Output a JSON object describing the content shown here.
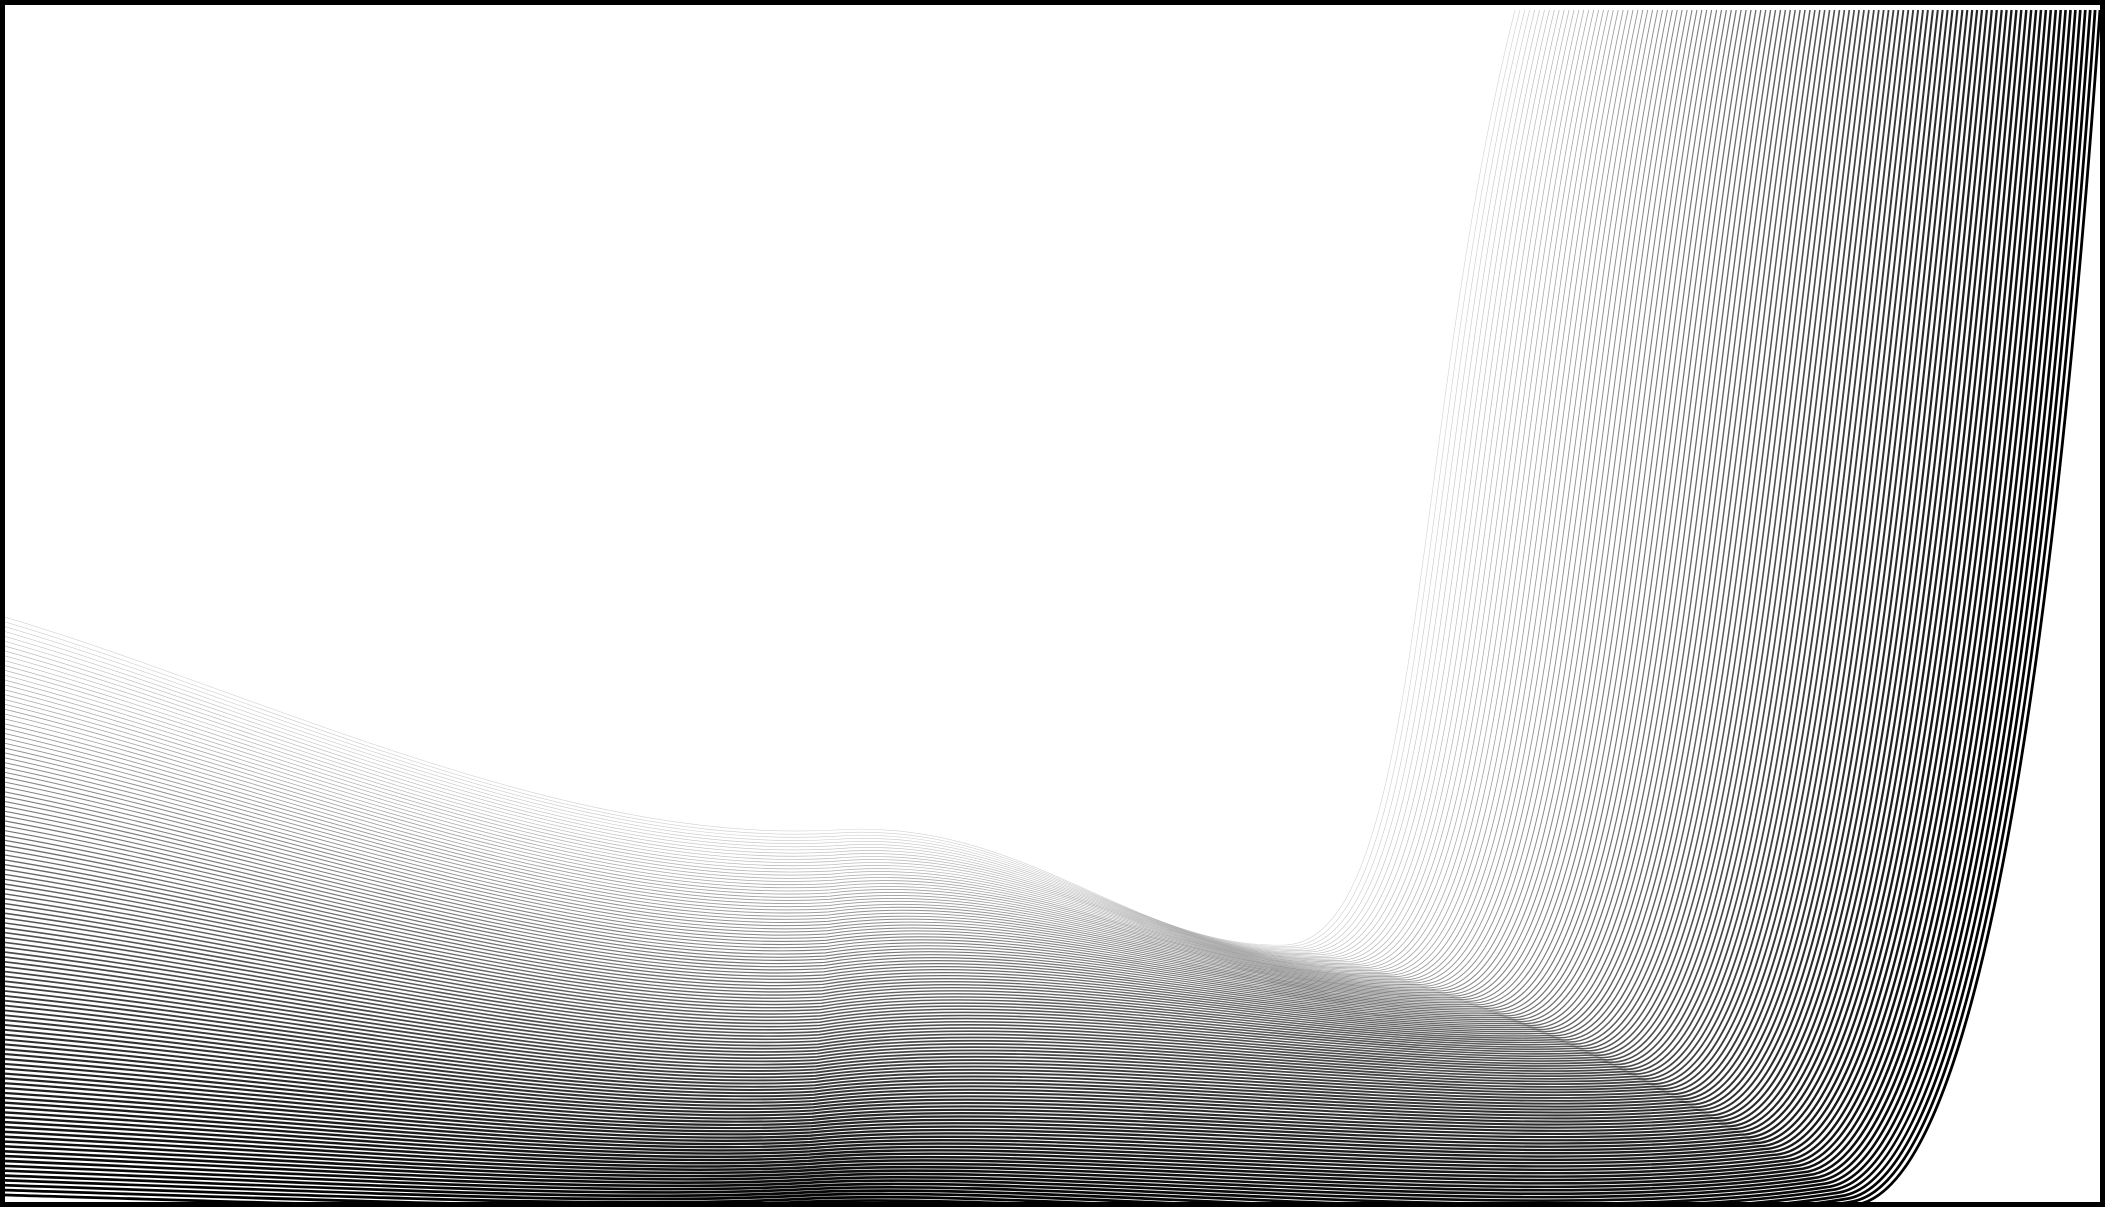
{
  "artwork": {
    "kind": "abstract line-art wave background",
    "background_color": "#ffffff",
    "line_color": "#000000",
    "frame_color": "#000000",
    "line_count": 120,
    "style": "fine contour lines, dense and dark at bottom-left and far right, fading to light grey toward the top-center"
  }
}
